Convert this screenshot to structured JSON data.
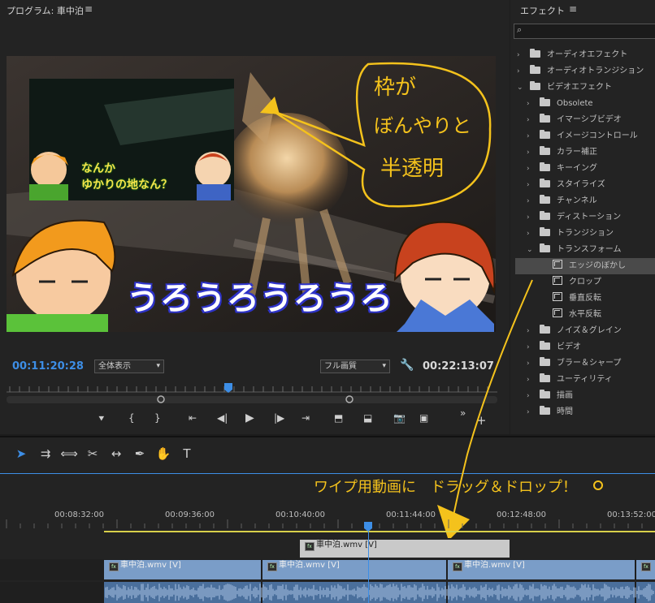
{
  "program": {
    "title": "プログラム: 車中泊",
    "menu_icon": "≡",
    "timecode_current": "00:11:20:28",
    "timecode_total": "00:22:13:07",
    "zoom_select": "全体表示",
    "quality_select": "フル画質"
  },
  "video": {
    "caption_small_1": "なんか",
    "caption_small_2": "ゆかりの地なん？",
    "big_text": "うろうろうろうろ",
    "note_1": "枠が",
    "note_2": "ぼんやりと",
    "note_3": "半透明"
  },
  "effects_panel": {
    "title": "エフェクト",
    "menu_icon": "≡",
    "search_placeholder": "",
    "items": [
      {
        "label": "オーディオエフェクト",
        "level": 0,
        "expanded": false
      },
      {
        "label": "オーディオトランジション",
        "level": 0,
        "expanded": false
      },
      {
        "label": "ビデオエフェクト",
        "level": 0,
        "expanded": true
      },
      {
        "label": "Obsolete",
        "level": 1,
        "expanded": false
      },
      {
        "label": "イマーシブビデオ",
        "level": 1,
        "expanded": false
      },
      {
        "label": "イメージコントロール",
        "level": 1,
        "expanded": false
      },
      {
        "label": "カラー補正",
        "level": 1,
        "expanded": false
      },
      {
        "label": "キーイング",
        "level": 1,
        "expanded": false
      },
      {
        "label": "スタイライズ",
        "level": 1,
        "expanded": false
      },
      {
        "label": "チャンネル",
        "level": 1,
        "expanded": false
      },
      {
        "label": "ディストーション",
        "level": 1,
        "expanded": false
      },
      {
        "label": "トランジション",
        "level": 1,
        "expanded": false
      },
      {
        "label": "トランスフォーム",
        "level": 1,
        "expanded": true
      },
      {
        "label": "エッジのぼかし",
        "level": 2,
        "selected": true
      },
      {
        "label": "クロップ",
        "level": 2
      },
      {
        "label": "垂直反転",
        "level": 2
      },
      {
        "label": "水平反転",
        "level": 2
      },
      {
        "label": "ノイズ＆グレイン",
        "level": 1,
        "expanded": false
      },
      {
        "label": "ビデオ",
        "level": 1,
        "expanded": false
      },
      {
        "label": "ブラー＆シャープ",
        "level": 1,
        "expanded": false
      },
      {
        "label": "ユーティリティ",
        "level": 1,
        "expanded": false
      },
      {
        "label": "描画",
        "level": 1,
        "expanded": false
      },
      {
        "label": "時間",
        "level": 1,
        "expanded": false
      }
    ]
  },
  "timeline": {
    "ruler_labels": [
      "00:08:32:00",
      "00:09:36:00",
      "00:10:40:00",
      "00:11:44:00",
      "00:12:48:00",
      "00:13:52:00"
    ],
    "annotation": "ワイプ用動画に　ドラッグ＆ドロップ！",
    "clips_v2": [
      {
        "label": "車中泊.wmv [V]"
      }
    ],
    "clips_v1": [
      {
        "label": "車中泊.wmv [V]"
      },
      {
        "label": "車中泊.wmv [V]"
      },
      {
        "label": "車中泊.wmv [V]"
      }
    ]
  },
  "colors": {
    "accent_blue": "#3d8ee6",
    "clip_blue": "#7a9dc8",
    "clip_gray": "#c9c9c9",
    "annotation_yellow": "#f4c21c"
  }
}
